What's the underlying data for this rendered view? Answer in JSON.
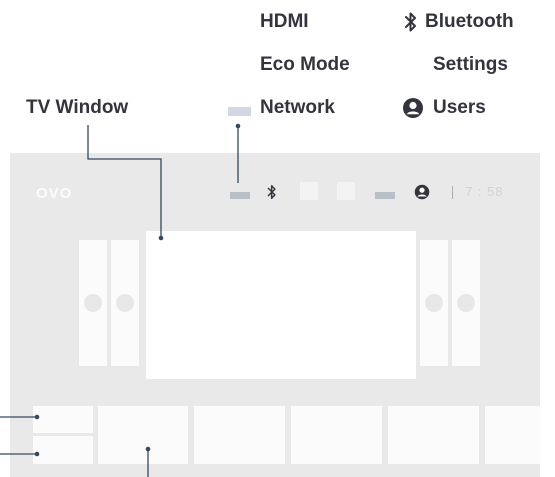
{
  "labels": {
    "hdmi": "HDMI",
    "eco_mode": "Eco Mode",
    "network": "Network",
    "bluetooth": "Bluetooth",
    "settings": "Settings",
    "users": "Users",
    "tv_window": "TV Window"
  },
  "status_bar": {
    "logo": "OVO",
    "time": "7 : 58"
  },
  "icons": {
    "bluetooth": "bluetooth-icon",
    "user": "user-icon",
    "network": "network-icon"
  },
  "colors": {
    "label_text": "#34343f",
    "screen_bg": "#e9e9ea",
    "leader_line": "#34495e",
    "network_bar": "#b9bfc7"
  }
}
